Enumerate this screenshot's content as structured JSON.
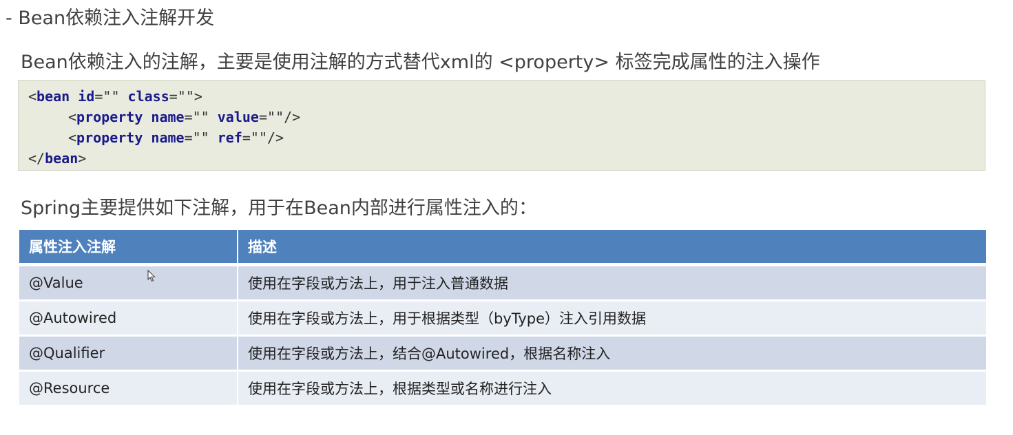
{
  "heading": "- Bean依赖注入注解开发",
  "intro": "Bean依赖注入的注解，主要是使用注解的方式替代xml的 <property> 标签完成属性的注入操作",
  "code": {
    "line1": [
      "<",
      "bean",
      " ",
      "id",
      "=\"\" ",
      "class",
      "=\"\">"
    ],
    "line2": [
      "<",
      "property",
      " ",
      "name",
      "=\"\" ",
      "value",
      "=\"\"/>"
    ],
    "line3": [
      "<",
      "property",
      " ",
      "name",
      "=\"\" ",
      "ref",
      "=\"\"/>"
    ],
    "line4": [
      "</",
      "bean",
      ">"
    ]
  },
  "section2": "Spring主要提供如下注解，用于在Bean内部进行属性注入的：",
  "table": {
    "headers": [
      "属性注入注解",
      "描述"
    ],
    "rows": [
      [
        "@Value",
        "使用在字段或方法上，用于注入普通数据"
      ],
      [
        "@Autowired",
        "使用在字段或方法上，用于根据类型（byType）注入引用数据"
      ],
      [
        "@Qualifier",
        "使用在字段或方法上，结合@Autowired，根据名称注入"
      ],
      [
        "@Resource",
        "使用在字段或方法上，根据类型或名称进行注入"
      ]
    ]
  },
  "colors": {
    "header_bg": "#4f81bd",
    "row_odd": "#d0d8e8",
    "row_even": "#e9edf4",
    "code_bg": "#e8ebdd"
  },
  "icons": {
    "cursor": "mouse-pointer-icon"
  }
}
